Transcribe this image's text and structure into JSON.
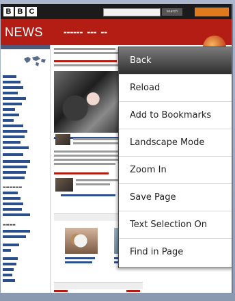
{
  "header": {
    "logo_letters": [
      "B",
      "B",
      "C"
    ],
    "search_label": "search"
  },
  "news_banner": {
    "title": "NEWS"
  },
  "context_menu": {
    "items": [
      {
        "label": "Back",
        "selected": true
      },
      {
        "label": "Reload",
        "selected": false
      },
      {
        "label": "Add to Bookmarks",
        "selected": false
      },
      {
        "label": "Landscape Mode",
        "selected": false
      },
      {
        "label": "Zoom In",
        "selected": false
      },
      {
        "label": "Save Page",
        "selected": false
      },
      {
        "label": "Text Selection On",
        "selected": false
      },
      {
        "label": "Find in Page",
        "selected": false
      }
    ]
  },
  "colors": {
    "bbc_header": "#1b1b1b",
    "news_red": "#b31d14",
    "menu_selected": "#2f2f2f",
    "link_blue": "#2b4e8c"
  }
}
